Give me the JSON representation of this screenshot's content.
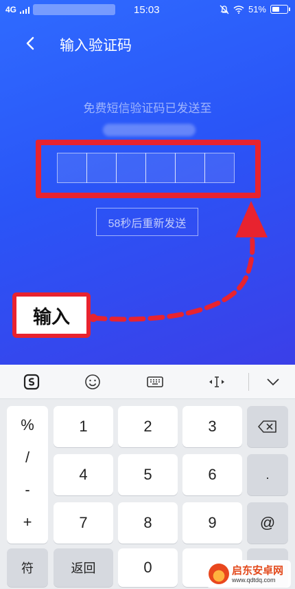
{
  "status": {
    "network": "4G",
    "time": "15:03",
    "battery": "51%",
    "battery_level": 0.51
  },
  "nav": {
    "title": "输入验证码"
  },
  "verify": {
    "hint": "免费短信验证码已发送至",
    "resend_label": "58秒后重新发送"
  },
  "annotation": {
    "tag": "输入",
    "color": "#e8232f"
  },
  "keyboard": {
    "side_keys": [
      "%",
      "/",
      "-",
      "+"
    ],
    "rows": [
      [
        "1",
        "2",
        "3"
      ],
      [
        "4",
        "5",
        "6"
      ],
      [
        "7",
        "8",
        "9"
      ]
    ],
    "right_keys": [
      ".",
      "@"
    ],
    "bottom": {
      "symbol": "符",
      "back": "返回",
      "zero": "0"
    }
  },
  "watermark": {
    "title": "启东安卓网",
    "url": "www.qdtdq.com"
  },
  "colors": {
    "accent": "#2f6bff",
    "annotation_red": "#e8232f"
  }
}
